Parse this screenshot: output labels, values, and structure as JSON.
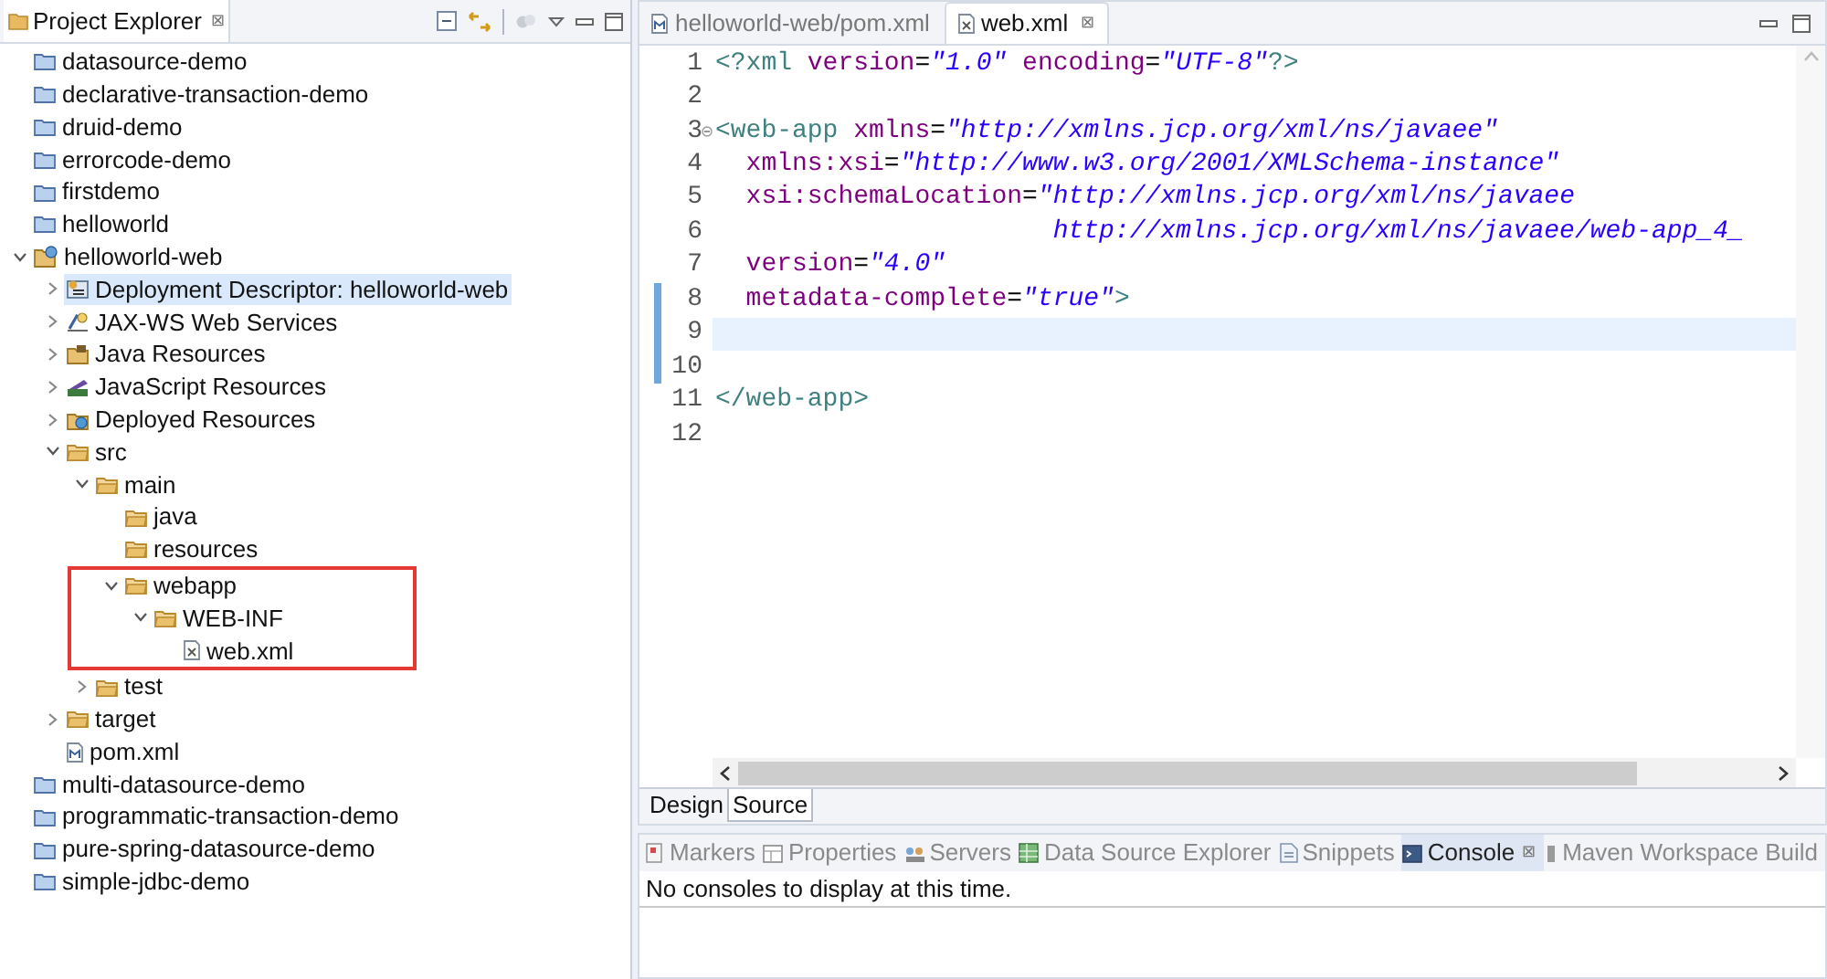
{
  "explorer": {
    "title": "Project Explorer",
    "close": "⊠",
    "tree": [
      {
        "label": "datasource-demo",
        "kind": "project",
        "selected": false
      },
      {
        "label": "declarative-transaction-demo",
        "kind": "project",
        "selected": false
      },
      {
        "label": "druid-demo",
        "kind": "project",
        "selected": false
      },
      {
        "label": "errorcode-demo",
        "kind": "project",
        "selected": false
      },
      {
        "label": "firstdemo",
        "kind": "project",
        "selected": false
      },
      {
        "label": "helloworld",
        "kind": "project",
        "selected": false
      },
      {
        "label": "helloworld-web",
        "kind": "web-project",
        "selected": false,
        "expanded": true,
        "children": [
          {
            "label": "Deployment Descriptor: helloworld-web",
            "kind": "descriptor",
            "selected": true,
            "expanded": false
          },
          {
            "label": "JAX-WS Web Services",
            "kind": "services",
            "selected": false,
            "expanded": false
          },
          {
            "label": "Java Resources",
            "kind": "java-res",
            "selected": false,
            "expanded": false
          },
          {
            "label": "JavaScript Resources",
            "kind": "js-res",
            "selected": false,
            "expanded": false
          },
          {
            "label": "Deployed Resources",
            "kind": "deployed",
            "selected": false,
            "expanded": false
          },
          {
            "label": "src",
            "kind": "folder",
            "selected": false,
            "expanded": true,
            "children": [
              {
                "label": "main",
                "kind": "folder",
                "selected": false,
                "expanded": true,
                "children": [
                  {
                    "label": "java",
                    "kind": "folder",
                    "selected": false,
                    "highlighted": false
                  },
                  {
                    "label": "resources",
                    "kind": "folder",
                    "selected": false,
                    "highlighted": false
                  },
                  {
                    "label": "webapp",
                    "kind": "folder",
                    "selected": false,
                    "highlighted": true,
                    "expanded": true,
                    "children": [
                      {
                        "label": "WEB-INF",
                        "kind": "folder",
                        "selected": false,
                        "expanded": true,
                        "children": [
                          {
                            "label": "web.xml",
                            "kind": "xml-file",
                            "selected": false
                          }
                        ]
                      }
                    ]
                  }
                ]
              },
              {
                "label": "test",
                "kind": "folder",
                "selected": false,
                "expanded": false
              }
            ]
          },
          {
            "label": "target",
            "kind": "folder",
            "selected": false,
            "expanded": false
          },
          {
            "label": "pom.xml",
            "kind": "pom-file",
            "selected": false
          }
        ]
      },
      {
        "label": "multi-datasource-demo",
        "kind": "project",
        "selected": false
      },
      {
        "label": "programmatic-transaction-demo",
        "kind": "project",
        "selected": false
      },
      {
        "label": "pure-spring-datasource-demo",
        "kind": "project",
        "selected": false
      },
      {
        "label": "simple-jdbc-demo",
        "kind": "project",
        "selected": false
      }
    ]
  },
  "editor": {
    "tabs": [
      {
        "label": "helloworld-web/pom.xml",
        "kind": "pom-file",
        "selected": false
      },
      {
        "label": "web.xml",
        "kind": "xml-file",
        "selected": true,
        "close": "⊠"
      }
    ],
    "lines": [
      {
        "number": "1",
        "tokens": [
          {
            "kind": "tag",
            "text": "<?xml"
          },
          {
            "kind": "attr",
            "text": " version"
          },
          {
            "kind": "plain",
            "text": "="
          },
          {
            "kind": "value",
            "text": "\"1.0\""
          },
          {
            "kind": "attr",
            "text": " encoding"
          },
          {
            "kind": "plain",
            "text": "="
          },
          {
            "kind": "value",
            "text": "\"UTF-8\""
          },
          {
            "kind": "tag",
            "text": "?>"
          }
        ]
      },
      {
        "number": "2"
      },
      {
        "number": "3",
        "fold": true,
        "tokens": [
          {
            "kind": "tag",
            "text": "<web-app"
          },
          {
            "kind": "attr",
            "text": " xmlns"
          },
          {
            "kind": "plain",
            "text": "="
          },
          {
            "kind": "value",
            "text": "\"http://xmlns.jcp.org/xml/ns/javaee\""
          }
        ]
      },
      {
        "number": "4",
        "tokens": [
          {
            "kind": "attr",
            "text": "  xmlns:xsi"
          },
          {
            "kind": "plain",
            "text": "="
          },
          {
            "kind": "value",
            "text": "\"http://www.w3.org/2001/XMLSchema-instance\""
          }
        ]
      },
      {
        "number": "5",
        "tokens": [
          {
            "kind": "attr",
            "text": "  xsi:schemaLocation"
          },
          {
            "kind": "plain",
            "text": "="
          },
          {
            "kind": "value",
            "text": "\"http://xmlns.jcp.org/xml/ns/javaee"
          }
        ]
      },
      {
        "number": "6",
        "continuation": true,
        "tokens": [
          {
            "kind": "value",
            "text": "http://xmlns.jcp.org/xml/ns/javaee/web-app_4_"
          }
        ]
      },
      {
        "number": "7",
        "tokens": [
          {
            "kind": "attr",
            "text": "  version"
          },
          {
            "kind": "plain",
            "text": "="
          },
          {
            "kind": "value",
            "text": "\"4.0\""
          }
        ]
      },
      {
        "number": "8",
        "changed": true,
        "tokens": [
          {
            "kind": "attr",
            "text": "  metadata-complete"
          },
          {
            "kind": "plain",
            "text": "="
          },
          {
            "kind": "value",
            "text": "\"true\""
          },
          {
            "kind": "tag",
            "text": ">"
          }
        ]
      },
      {
        "number": "9",
        "changed": true,
        "current": true
      },
      {
        "number": "10",
        "changed": true
      },
      {
        "number": "11",
        "tokens": [
          {
            "kind": "tag",
            "text": "</web-app>"
          }
        ]
      },
      {
        "number": "12"
      }
    ],
    "page_tabs": [
      {
        "label": "Design",
        "selected": false
      },
      {
        "label": "Source",
        "selected": true
      }
    ]
  },
  "bottom": {
    "tabs": [
      {
        "label": "Markers",
        "kind": "markers",
        "selected": false
      },
      {
        "label": "Properties",
        "kind": "properties",
        "selected": false
      },
      {
        "label": "Servers",
        "kind": "servers",
        "selected": false
      },
      {
        "label": "Data Source Explorer",
        "kind": "datasource",
        "selected": false
      },
      {
        "label": "Snippets",
        "kind": "snippets",
        "selected": false
      },
      {
        "label": "Console",
        "kind": "console",
        "selected": true,
        "close": "⊠"
      },
      {
        "label": "Maven Workspace Build",
        "kind": "maven",
        "selected": false
      }
    ],
    "message": "No consoles to display at this time."
  }
}
